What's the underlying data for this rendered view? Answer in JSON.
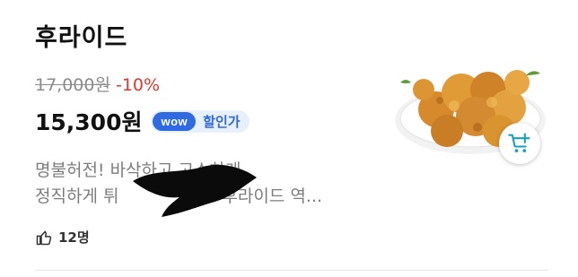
{
  "product": {
    "name": "후라이드",
    "original_price": "17,000원",
    "discount": "-10%",
    "price": "15,300원",
    "badge": "wow",
    "badge_label": "할인가",
    "description_line1": "명불허전! 바삭하고 고소하게",
    "description_line2": "정직하게 튀",
    "description_line2_end": "후라이드 역...",
    "likes": "12명"
  },
  "colors": {
    "discount": "#e5372a",
    "wow_badge": "#2f6ae0",
    "cart_icon": "#1aa0b8"
  },
  "icons": {
    "likes": "thumbs-up-icon",
    "cart": "add-to-cart-icon"
  }
}
